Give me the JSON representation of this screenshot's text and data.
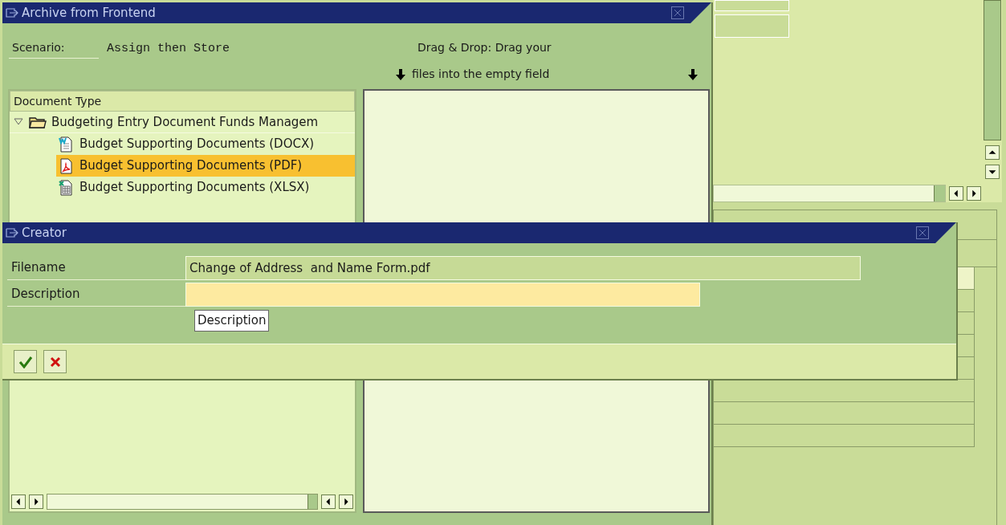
{
  "archive_dialog": {
    "title": "Archive from Frontend",
    "scenario_label": "Scenario:",
    "scenario_value": "Assign then Store",
    "drag_drop_line_1": "Drag & Drop: Drag your",
    "drag_drop_line_2": "files into the empty field",
    "tree": {
      "header": "Document Type",
      "items": [
        {
          "label": "Budgeting Entry Document Funds Managem",
          "expanded": true,
          "selected": false,
          "children": [
            {
              "label": "Budget Supporting Documents (DOCX)",
              "kind": "docx",
              "selected": false
            },
            {
              "label": "Budget Supporting Documents (PDF)",
              "kind": "pdf",
              "selected": true
            },
            {
              "label": "Budget Supporting Documents (XLSX)",
              "kind": "xlsx",
              "selected": false
            }
          ]
        }
      ]
    }
  },
  "creator_dialog": {
    "title": "Creator",
    "fields": [
      {
        "label": "Filename",
        "value": "Change of Address  and Name Form.pdf",
        "focused": false
      },
      {
        "label": "Description",
        "focused": true
      }
    ],
    "tooltip": "Description"
  }
}
